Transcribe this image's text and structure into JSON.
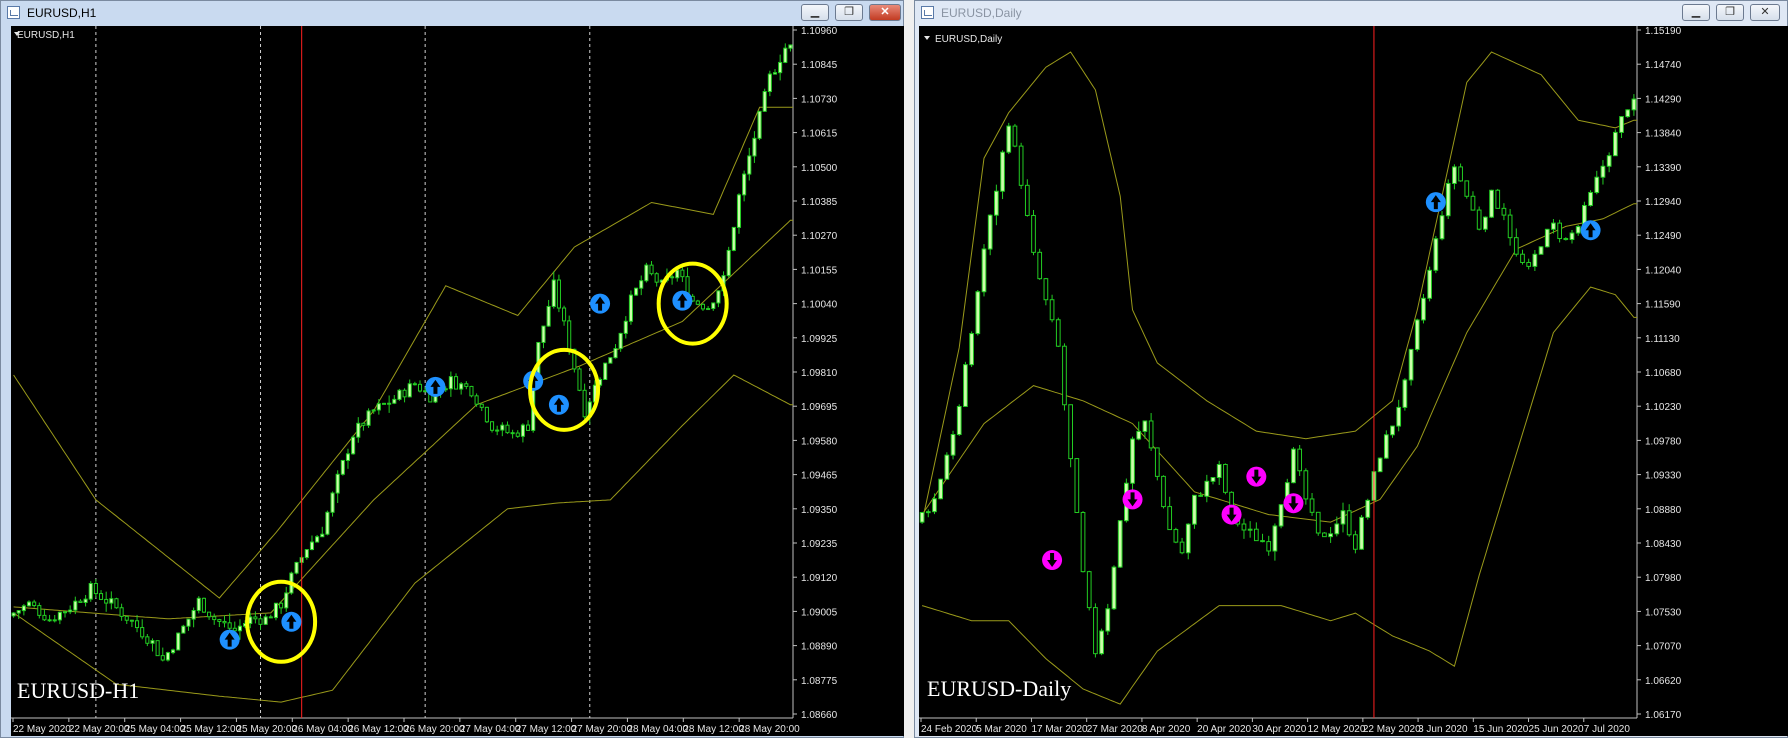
{
  "windows": [
    {
      "title": "EURUSD,H1",
      "label": "EURUSD,H1",
      "watermark": "EURUSD-H1",
      "controls": {
        "minimize": "▁",
        "maximize": "❐",
        "close": "✕"
      }
    },
    {
      "title": "EURUSD,Daily",
      "label": "EURUSD,Daily",
      "watermark": "EURUSD-Daily",
      "controls": {
        "minimize": "▁",
        "maximize": "❐",
        "close": "✕"
      }
    }
  ],
  "colors": {
    "background": "#000000",
    "candle": "#22cc22",
    "candle_bull_body": "#ccffaa",
    "bands": "#9a9a1a",
    "vline": "#ff2020",
    "arrow_up": "#1e90ff",
    "arrow_down": "#ff00ff",
    "highlight": "#ffff00",
    "axis_text": "#e6e6e6"
  },
  "chart_data": [
    {
      "type": "candlestick",
      "title": "EURUSD,H1",
      "ylim": [
        1.0866,
        1.1096
      ],
      "y_ticks": [
        "1.10960",
        "1.10845",
        "1.10730",
        "1.10615",
        "1.10500",
        "1.10385",
        "1.10270",
        "1.10155",
        "1.10040",
        "1.09925",
        "1.09810",
        "1.09695",
        "1.09580",
        "1.09465",
        "1.09350",
        "1.09235",
        "1.09120",
        "1.09005",
        "1.08890",
        "1.08775",
        "1.08660"
      ],
      "x_ticks": [
        "22 May 2020",
        "22 May 20:00",
        "25 May 04:00",
        "25 May 12:00",
        "25 May 20:00",
        "26 May 04:00",
        "26 May 12:00",
        "26 May 20:00",
        "27 May 04:00",
        "27 May 12:00",
        "27 May 20:00",
        "28 May 04:00",
        "28 May 12:00",
        "28 May 20:00"
      ],
      "close_path": [
        [
          0,
          1.0899
        ],
        [
          4,
          1.0903
        ],
        [
          8,
          1.0898
        ],
        [
          12,
          1.0902
        ],
        [
          16,
          1.0908
        ],
        [
          20,
          1.0903
        ],
        [
          24,
          1.0897
        ],
        [
          28,
          1.089
        ],
        [
          30,
          1.0884
        ],
        [
          33,
          1.0892
        ],
        [
          37,
          1.0904
        ],
        [
          40,
          1.0898
        ],
        [
          44,
          1.0894
        ],
        [
          47,
          1.0898
        ],
        [
          50,
          1.0898
        ],
        [
          53,
          1.0903
        ],
        [
          55,
          1.0912
        ],
        [
          58,
          1.0922
        ],
        [
          61,
          1.0928
        ],
        [
          64,
          1.0945
        ],
        [
          67,
          1.096
        ],
        [
          71,
          1.0968
        ],
        [
          75,
          1.0972
        ],
        [
          79,
          1.0977
        ],
        [
          82,
          1.0973
        ],
        [
          86,
          1.0978
        ],
        [
          90,
          1.0975
        ],
        [
          94,
          1.0963
        ],
        [
          98,
          1.096
        ],
        [
          101,
          1.0963
        ],
        [
          103,
          1.099
        ],
        [
          106,
          1.101
        ],
        [
          109,
          1.099
        ],
        [
          112,
          1.0968
        ],
        [
          115,
          1.098
        ],
        [
          118,
          1.099
        ],
        [
          121,
          1.1005
        ],
        [
          124,
          1.1015
        ],
        [
          127,
          1.101
        ],
        [
          130,
          1.1015
        ],
        [
          133,
          1.1005
        ],
        [
          136,
          1.1003
        ],
        [
          139,
          1.1012
        ],
        [
          142,
          1.104
        ],
        [
          145,
          1.106
        ],
        [
          148,
          1.108
        ],
        [
          151,
          1.109
        ]
      ],
      "bands_upper": [
        [
          0,
          1.098
        ],
        [
          16,
          1.0938
        ],
        [
          40,
          1.0905
        ],
        [
          51,
          1.0927
        ],
        [
          70,
          1.0968
        ],
        [
          84,
          1.101
        ],
        [
          98,
          1.1
        ],
        [
          109,
          1.1023
        ],
        [
          124,
          1.1038
        ],
        [
          136,
          1.1034
        ],
        [
          145,
          1.107
        ]
      ],
      "bands_middle": [
        [
          0,
          1.0902
        ],
        [
          30,
          1.0898
        ],
        [
          50,
          1.09
        ],
        [
          70,
          1.0938
        ],
        [
          90,
          1.097
        ],
        [
          110,
          1.0983
        ],
        [
          130,
          1.0998
        ],
        [
          151,
          1.1032
        ]
      ],
      "bands_lower": [
        [
          0,
          1.09
        ],
        [
          20,
          1.0876
        ],
        [
          40,
          1.0872
        ],
        [
          52,
          1.087
        ],
        [
          62,
          1.0874
        ],
        [
          78,
          1.091
        ],
        [
          96,
          1.0935
        ],
        [
          106,
          1.0937
        ],
        [
          116,
          1.0938
        ],
        [
          130,
          1.0963
        ],
        [
          140,
          1.098
        ],
        [
          151,
          1.097
        ]
      ],
      "n_bars": 152,
      "vline_bar": 56,
      "dashed_bars": [
        16,
        48,
        80,
        112
      ],
      "buy_arrows": [
        [
          42,
          1.0891
        ],
        [
          54,
          1.0897
        ],
        [
          82,
          1.0976
        ],
        [
          101,
          1.0978
        ],
        [
          106,
          1.097
        ],
        [
          114,
          1.1004
        ],
        [
          130,
          1.1005
        ]
      ],
      "highlights": [
        [
          52,
          1.0897
        ],
        [
          107,
          1.0975
        ],
        [
          132,
          1.1004
        ]
      ]
    },
    {
      "type": "candlestick",
      "title": "EURUSD,Daily",
      "ylim": [
        1.0617,
        1.1519
      ],
      "y_ticks": [
        "1.15190",
        "1.14740",
        "1.14290",
        "1.13840",
        "1.13390",
        "1.12940",
        "1.12490",
        "1.12040",
        "1.11590",
        "1.11130",
        "1.10680",
        "1.10230",
        "1.09780",
        "1.09330",
        "1.08880",
        "1.08430",
        "1.07980",
        "1.07530",
        "1.07070",
        "1.06620",
        "1.06170"
      ],
      "x_ticks": [
        "24 Feb 2020",
        "5 Mar 2020",
        "17 Mar 2020",
        "27 Mar 2020",
        "8 Apr 2020",
        "20 Apr 2020",
        "30 Apr 2020",
        "12 May 2020",
        "22 May 2020",
        "3 Jun 2020",
        "15 Jun 2020",
        "25 Jun 2020",
        "7 Jul 2020"
      ],
      "close_path": [
        [
          0,
          1.087
        ],
        [
          3,
          1.09
        ],
        [
          5,
          1.096
        ],
        [
          7,
          1.102
        ],
        [
          9,
          1.112
        ],
        [
          11,
          1.123
        ],
        [
          13,
          1.131
        ],
        [
          15,
          1.14
        ],
        [
          17,
          1.132
        ],
        [
          19,
          1.122
        ],
        [
          21,
          1.116
        ],
        [
          23,
          1.11
        ],
        [
          25,
          1.095
        ],
        [
          27,
          1.08
        ],
        [
          29,
          1.07
        ],
        [
          31,
          1.076
        ],
        [
          33,
          1.087
        ],
        [
          35,
          1.098
        ],
        [
          37,
          1.1
        ],
        [
          39,
          1.093
        ],
        [
          41,
          1.086
        ],
        [
          43,
          1.083
        ],
        [
          45,
          1.09
        ],
        [
          47,
          1.092
        ],
        [
          49,
          1.094
        ],
        [
          51,
          1.088
        ],
        [
          53,
          1.086
        ],
        [
          55,
          1.085
        ],
        [
          57,
          1.084
        ],
        [
          59,
          1.09
        ],
        [
          61,
          1.096
        ],
        [
          63,
          1.09
        ],
        [
          65,
          1.085
        ],
        [
          67,
          1.086
        ],
        [
          69,
          1.088
        ],
        [
          71,
          1.084
        ],
        [
          73,
          1.09
        ],
        [
          75,
          1.096
        ],
        [
          77,
          1.1
        ],
        [
          79,
          1.105
        ],
        [
          81,
          1.113
        ],
        [
          83,
          1.12
        ],
        [
          85,
          1.128
        ],
        [
          87,
          1.134
        ],
        [
          89,
          1.13
        ],
        [
          91,
          1.126
        ],
        [
          93,
          1.13
        ],
        [
          95,
          1.128
        ],
        [
          97,
          1.122
        ],
        [
          99,
          1.12
        ],
        [
          101,
          1.124
        ],
        [
          103,
          1.126
        ],
        [
          105,
          1.124
        ],
        [
          107,
          1.126
        ],
        [
          109,
          1.13
        ],
        [
          111,
          1.134
        ],
        [
          113,
          1.138
        ],
        [
          115,
          1.142
        ]
      ],
      "bands_upper": [
        [
          0,
          1.087
        ],
        [
          6,
          1.11
        ],
        [
          10,
          1.135
        ],
        [
          14,
          1.141
        ],
        [
          20,
          1.147
        ],
        [
          24,
          1.149
        ],
        [
          28,
          1.144
        ],
        [
          32,
          1.13
        ],
        [
          34,
          1.115
        ],
        [
          38,
          1.108
        ],
        [
          46,
          1.103
        ],
        [
          54,
          1.099
        ],
        [
          62,
          1.098
        ],
        [
          70,
          1.099
        ],
        [
          76,
          1.103
        ],
        [
          80,
          1.115
        ],
        [
          84,
          1.13
        ],
        [
          88,
          1.145
        ],
        [
          92,
          1.149
        ],
        [
          100,
          1.146
        ],
        [
          106,
          1.14
        ],
        [
          112,
          1.139
        ],
        [
          115,
          1.14
        ]
      ],
      "bands_middle": [
        [
          0,
          1.088
        ],
        [
          10,
          1.1
        ],
        [
          18,
          1.105
        ],
        [
          26,
          1.103
        ],
        [
          34,
          1.1
        ],
        [
          44,
          1.091
        ],
        [
          56,
          1.088
        ],
        [
          66,
          1.087
        ],
        [
          74,
          1.09
        ],
        [
          80,
          1.097
        ],
        [
          88,
          1.112
        ],
        [
          96,
          1.123
        ],
        [
          104,
          1.126
        ],
        [
          110,
          1.127
        ],
        [
          115,
          1.129
        ]
      ],
      "bands_lower": [
        [
          0,
          1.076
        ],
        [
          8,
          1.074
        ],
        [
          14,
          1.074
        ],
        [
          20,
          1.069
        ],
        [
          26,
          1.065
        ],
        [
          32,
          1.063
        ],
        [
          38,
          1.07
        ],
        [
          48,
          1.076
        ],
        [
          58,
          1.076
        ],
        [
          66,
          1.074
        ],
        [
          70,
          1.075
        ],
        [
          76,
          1.072
        ],
        [
          82,
          1.07
        ],
        [
          86,
          1.068
        ],
        [
          90,
          1.08
        ],
        [
          96,
          1.096
        ],
        [
          102,
          1.112
        ],
        [
          108,
          1.118
        ],
        [
          112,
          1.117
        ],
        [
          115,
          1.114
        ]
      ],
      "n_bars": 116,
      "vline_bar": 73,
      "buy_arrows": [
        [
          83,
          1.1292
        ],
        [
          108,
          1.1255
        ]
      ],
      "sell_arrows": [
        [
          21,
          1.082
        ],
        [
          34,
          1.09
        ],
        [
          50,
          1.088
        ],
        [
          54,
          1.093
        ],
        [
          60,
          1.0895
        ]
      ]
    }
  ]
}
